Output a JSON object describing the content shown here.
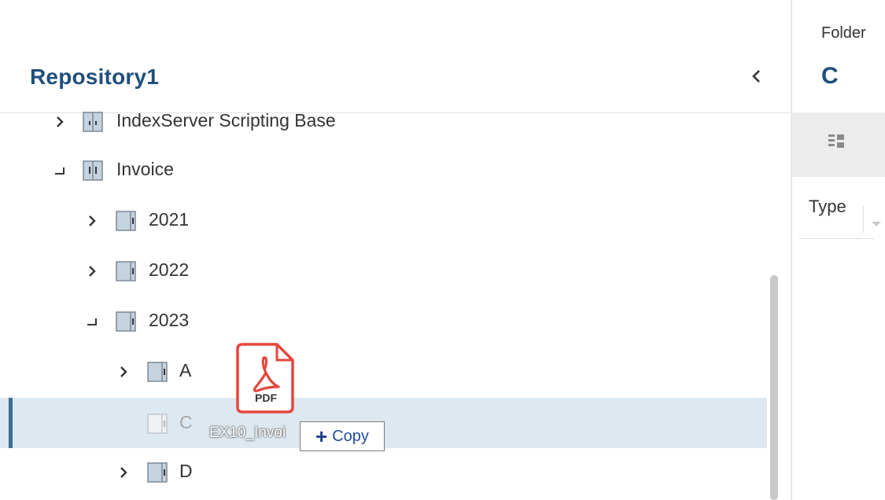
{
  "repository": {
    "title": "Repository1",
    "collapse_icon": "chevron-left-icon"
  },
  "tree": [
    {
      "label": "IndexServer Scripting Base",
      "state": "collapsed",
      "icon": "cabinet-icon",
      "level": 1
    },
    {
      "label": "Invoice",
      "state": "expanded",
      "icon": "cabinet-icon",
      "level": 1
    },
    {
      "label": "2021",
      "state": "collapsed",
      "icon": "folder-icon",
      "level": 2
    },
    {
      "label": "2022",
      "state": "collapsed",
      "icon": "folder-icon",
      "level": 2
    },
    {
      "label": "2023",
      "state": "expanded",
      "icon": "folder-icon",
      "level": 2
    },
    {
      "label": "A",
      "state": "collapsed",
      "icon": "folder-icon",
      "level": 3
    },
    {
      "label": "C",
      "state": "leaf",
      "icon": "folder-icon",
      "level": 3,
      "selected": true,
      "disabled": true
    },
    {
      "label": "D",
      "state": "collapsed",
      "icon": "folder-icon",
      "level": 3
    }
  ],
  "drag": {
    "file_icon": "pdf-file-icon",
    "file_type_label": "PDF",
    "file_name": "EX10_Invoi",
    "action_label": "Copy",
    "action_icon": "plus-icon"
  },
  "detail": {
    "folder_label": "Folder",
    "folder_name": "C",
    "view_icon": "grid-view-icon",
    "column_header": "Type"
  },
  "colors": {
    "accent": "#1f4f7c",
    "selection": "#dde8f0",
    "selection_bar": "#3c6e98",
    "pdf_red": "#e8463b"
  }
}
